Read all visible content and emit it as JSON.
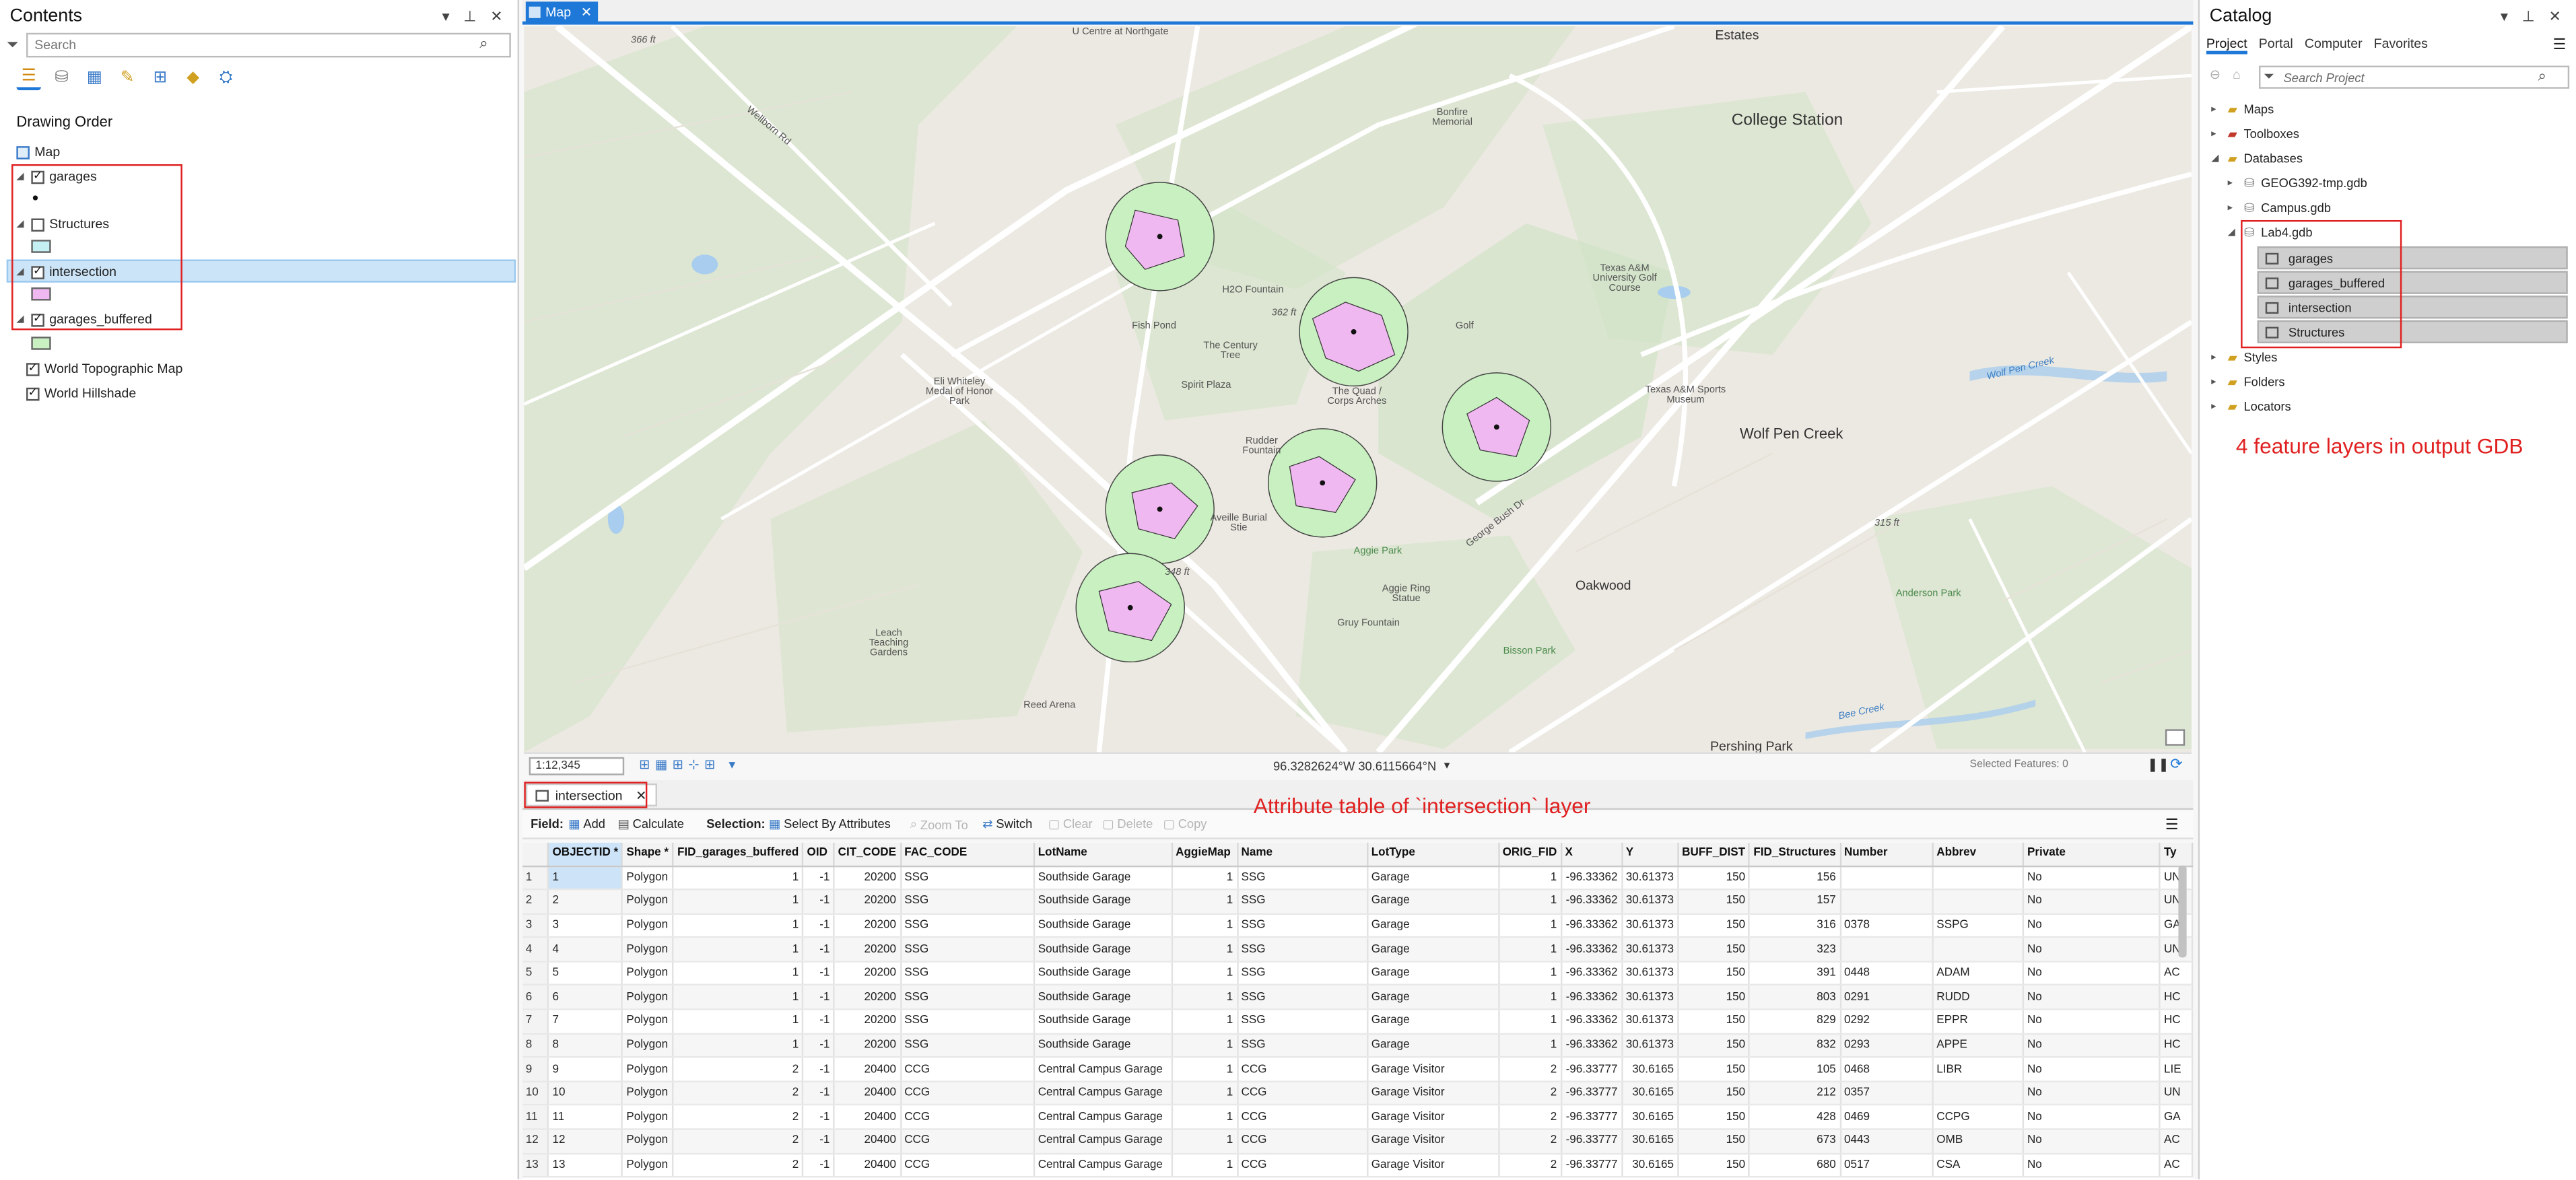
{
  "contents": {
    "title": "Contents",
    "search_placeholder": "Search",
    "drawing_order": "Drawing Order",
    "map_label": "Map",
    "layers": [
      {
        "name": "garages",
        "checked": true
      },
      {
        "name": "Structures",
        "checked": false
      },
      {
        "name": "intersection",
        "checked": true
      },
      {
        "name": "garages_buffered",
        "checked": true
      },
      {
        "name": "World Topographic Map",
        "checked": true
      },
      {
        "name": "World Hillshade",
        "checked": true
      }
    ]
  },
  "map": {
    "tab_label": "Map",
    "scale": "1:12,345",
    "coordinates": "96.3282624°W 30.6115664°N",
    "selected_features": "Selected Features: 0",
    "labels": {
      "college_station": "College Station",
      "wolf_pen_creek": "Wolf Pen Creek",
      "oakwood": "Oakwood",
      "pershing_park": "Pershing Park",
      "estates": "Estates",
      "u_centre": "U Centre at Northgate",
      "bonfire": "Bonfire Memorial",
      "h2o": "H2O Fountain",
      "fish_pond": "Fish Pond",
      "century_tree": "The Century Tree",
      "spirit_plaza": "Spirit Plaza",
      "eli_whiteley": "Eli Whiteley Medal of Honor Park",
      "rudder_fountain": "Rudder Fountain",
      "quad": "The Quad / Corps Arches",
      "golf": "Golf",
      "golf_course": "Texas A&M University Golf Course",
      "sports_museum": "Texas A&M Sports Museum",
      "burial": "Aveille Burial Stie",
      "aggie_park": "Aggie Park",
      "aggie_ring": "Aggie Ring Statue",
      "gruy": "Gruy Fountain",
      "leach": "Leach Teaching Gardens",
      "reed_arena": "Reed Arena",
      "anderson_park": "Anderson Park",
      "bisson_park": "Bisson Park",
      "bee_creek": "Bee Creek",
      "wolf_pen_water": "Wolf Pen Creek",
      "george_bush_dr": "George Bush Dr",
      "wellborn_rd": "Wellborn Rd",
      "elev_366": "366 ft",
      "elev_362": "362 ft",
      "elev_315": "315 ft",
      "elev_348": "348 ft"
    }
  },
  "attribute_table": {
    "tab_label": "intersection",
    "toolbar": {
      "field": "Field:",
      "add": "Add",
      "calculate": "Calculate",
      "selection": "Selection:",
      "select_by_attributes": "Select By Attributes",
      "zoom_to": "Zoom To",
      "switch": "Switch",
      "clear": "Clear",
      "delete": "Delete",
      "copy": "Copy"
    },
    "columns": [
      "OBJECTID *",
      "Shape *",
      "FID_garages_buffered",
      "OID",
      "CIT_CODE",
      "FAC_CODE",
      "LotName",
      "AggieMap",
      "Name",
      "LotType",
      "ORIG_FID",
      "X",
      "Y",
      "BUFF_DIST",
      "FID_Structures",
      "Number",
      "Abbrev",
      "Private",
      "Ty"
    ],
    "rows": [
      [
        "1",
        "Polygon",
        "1",
        "-1",
        "20200",
        "SSG",
        "Southside Garage",
        "1",
        "SSG",
        "Garage",
        "1",
        "-96.33362",
        "30.61373",
        "150",
        "156",
        "",
        "",
        "No",
        "UN"
      ],
      [
        "2",
        "Polygon",
        "1",
        "-1",
        "20200",
        "SSG",
        "Southside Garage",
        "1",
        "SSG",
        "Garage",
        "1",
        "-96.33362",
        "30.61373",
        "150",
        "157",
        "",
        "",
        "No",
        "UN"
      ],
      [
        "3",
        "Polygon",
        "1",
        "-1",
        "20200",
        "SSG",
        "Southside Garage",
        "1",
        "SSG",
        "Garage",
        "1",
        "-96.33362",
        "30.61373",
        "150",
        "316",
        "0378",
        "SSPG",
        "No",
        "GA"
      ],
      [
        "4",
        "Polygon",
        "1",
        "-1",
        "20200",
        "SSG",
        "Southside Garage",
        "1",
        "SSG",
        "Garage",
        "1",
        "-96.33362",
        "30.61373",
        "150",
        "323",
        "",
        "",
        "No",
        "UN"
      ],
      [
        "5",
        "Polygon",
        "1",
        "-1",
        "20200",
        "SSG",
        "Southside Garage",
        "1",
        "SSG",
        "Garage",
        "1",
        "-96.33362",
        "30.61373",
        "150",
        "391",
        "0448",
        "ADAM",
        "No",
        "AC"
      ],
      [
        "6",
        "Polygon",
        "1",
        "-1",
        "20200",
        "SSG",
        "Southside Garage",
        "1",
        "SSG",
        "Garage",
        "1",
        "-96.33362",
        "30.61373",
        "150",
        "803",
        "0291",
        "RUDD",
        "No",
        "HC"
      ],
      [
        "7",
        "Polygon",
        "1",
        "-1",
        "20200",
        "SSG",
        "Southside Garage",
        "1",
        "SSG",
        "Garage",
        "1",
        "-96.33362",
        "30.61373",
        "150",
        "829",
        "0292",
        "EPPR",
        "No",
        "HC"
      ],
      [
        "8",
        "Polygon",
        "1",
        "-1",
        "20200",
        "SSG",
        "Southside Garage",
        "1",
        "SSG",
        "Garage",
        "1",
        "-96.33362",
        "30.61373",
        "150",
        "832",
        "0293",
        "APPE",
        "No",
        "HC"
      ],
      [
        "9",
        "Polygon",
        "2",
        "-1",
        "20400",
        "CCG",
        "Central Campus Garage",
        "1",
        "CCG",
        "Garage Visitor",
        "2",
        "-96.33777",
        "30.6165",
        "150",
        "105",
        "0468",
        "LIBR",
        "No",
        "LIE"
      ],
      [
        "10",
        "Polygon",
        "2",
        "-1",
        "20400",
        "CCG",
        "Central Campus Garage",
        "1",
        "CCG",
        "Garage Visitor",
        "2",
        "-96.33777",
        "30.6165",
        "150",
        "212",
        "0357",
        "",
        "No",
        "UN"
      ],
      [
        "11",
        "Polygon",
        "2",
        "-1",
        "20400",
        "CCG",
        "Central Campus Garage",
        "1",
        "CCG",
        "Garage Visitor",
        "2",
        "-96.33777",
        "30.6165",
        "150",
        "428",
        "0469",
        "CCPG",
        "No",
        "GA"
      ],
      [
        "12",
        "Polygon",
        "2",
        "-1",
        "20400",
        "CCG",
        "Central Campus Garage",
        "1",
        "CCG",
        "Garage Visitor",
        "2",
        "-96.33777",
        "30.6165",
        "150",
        "673",
        "0443",
        "OMB",
        "No",
        "AC"
      ],
      [
        "13",
        "Polygon",
        "2",
        "-1",
        "20400",
        "CCG",
        "Central Campus Garage",
        "1",
        "CCG",
        "Garage Visitor",
        "2",
        "-96.33777",
        "30.6165",
        "150",
        "680",
        "0517",
        "CSA",
        "No",
        "AC"
      ]
    ]
  },
  "catalog": {
    "title": "Catalog",
    "tabs": [
      "Project",
      "Portal",
      "Computer",
      "Favorites"
    ],
    "search_placeholder": "Search Project",
    "items": {
      "maps": "Maps",
      "toolboxes": "Toolboxes",
      "databases": "Databases",
      "geog_gdb": "GEOG392-tmp.gdb",
      "campus_gdb": "Campus.gdb",
      "lab4_gdb": "Lab4.gdb",
      "styles": "Styles",
      "folders": "Folders",
      "locators": "Locators"
    },
    "feature_classes": [
      "garages",
      "garages_buffered",
      "intersection",
      "Structures"
    ]
  },
  "annotations": {
    "gdb_note": "4 feature layers in output GDB",
    "table_note": "Attribute table of `intersection` layer"
  },
  "colors": {
    "accent": "#1e78d7",
    "annotation_red": "#e02020",
    "buffer_fill": "#c8f0c0",
    "intersection_fill": "#f0b8f0"
  }
}
